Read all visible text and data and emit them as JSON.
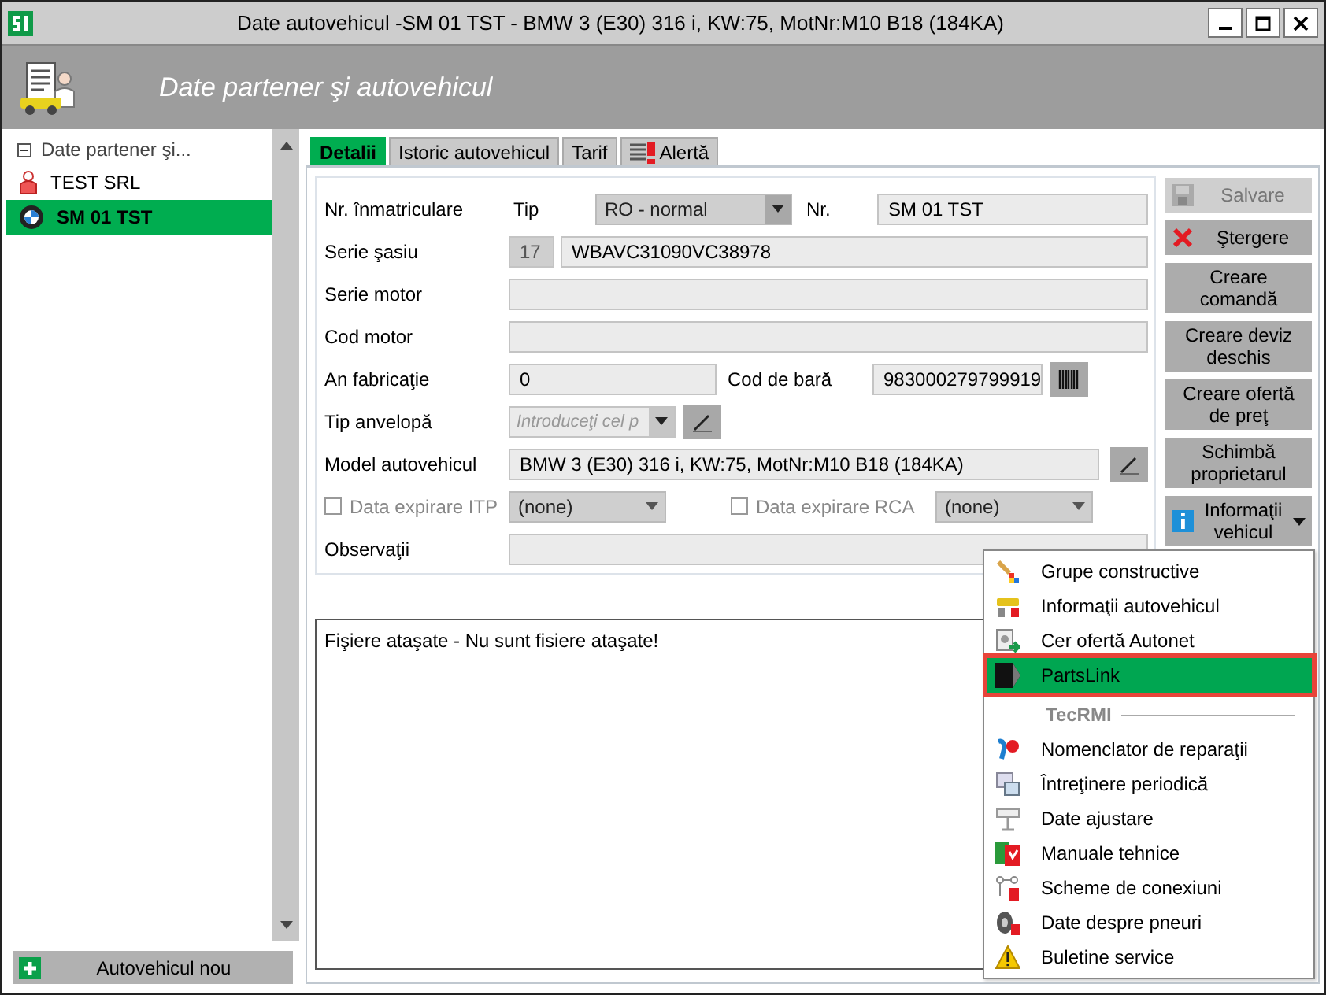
{
  "window": {
    "title": "Date autovehicul -SM 01 TST - BMW 3 (E30) 316 i, KW:75, MotNr:M10 B18 (184KA)"
  },
  "header": {
    "title": "Date partener şi autovehicul"
  },
  "tree": {
    "label": "Date partener şi...",
    "expanded": true,
    "children": [
      {
        "label": "TEST SRL",
        "kind": "partner",
        "selected": false
      },
      {
        "label": "SM 01 TST",
        "kind": "vehicle",
        "selected": true
      }
    ]
  },
  "new_vehicle_button": "Autovehicul nou",
  "tabs": [
    {
      "label": "Detalii",
      "selected": true
    },
    {
      "label": "Istoric autovehicul",
      "selected": false
    },
    {
      "label": "Tarif",
      "selected": false
    },
    {
      "label": "Alertă",
      "selected": false,
      "kind": "alert"
    }
  ],
  "form": {
    "registration": {
      "label": "Nr. înmatriculare",
      "type_label": "Tip",
      "type_value": "RO - normal",
      "number_label": "Nr.",
      "number_value": "SM 01 TST"
    },
    "chassis": {
      "label": "Serie şasiu",
      "length": "17",
      "value": "WBAVC31090VC38978"
    },
    "engine_series": {
      "label": "Serie motor"
    },
    "engine_code": {
      "label": "Cod motor"
    },
    "year": {
      "label": "An fabricaţie",
      "value": "0",
      "barcode_label": "Cod de bară",
      "barcode_value": "983000279799919"
    },
    "tire_type": {
      "label": "Tip anvelopă",
      "placeholder": "Introduceţi cel p"
    },
    "model": {
      "label": "Model autovehicul",
      "value": "BMW 3 (E30) 316 i, KW:75, MotNr:M10 B18 (184KA)"
    },
    "itp": {
      "label": "Data expirare ITP",
      "checked": false,
      "disabled": true,
      "value": "(none)"
    },
    "rca": {
      "label": "Data expirare RCA",
      "checked": false,
      "disabled": true,
      "value": "(none)"
    },
    "notes": {
      "label": "Observaţii"
    }
  },
  "actions": [
    {
      "label": "Salvare",
      "kind": "save",
      "disabled": true
    },
    {
      "label": "Ştergere",
      "kind": "delete",
      "disabled": false
    },
    {
      "label": "Creare comandă",
      "kind": "plain",
      "disabled": false
    },
    {
      "label": "Creare deviz deschis",
      "kind": "plain",
      "disabled": false
    },
    {
      "label": "Creare ofertă de preţ",
      "kind": "plain",
      "disabled": false
    },
    {
      "label": "Schimbă proprietarul",
      "kind": "plain",
      "disabled": false
    },
    {
      "label": "Informaţii vehicul",
      "kind": "info",
      "disabled": false
    }
  ],
  "attachments": {
    "text": "Fişiere ataşate - Nu sunt fisiere ataşate!"
  },
  "vehicle_menu": {
    "items": [
      {
        "kind": "item",
        "label": "Grupe constructive",
        "selected": false
      },
      {
        "kind": "item",
        "label": "Informaţii autovehicul",
        "selected": false
      },
      {
        "kind": "item",
        "label": "Cer ofertă Autonet",
        "selected": false
      },
      {
        "kind": "item",
        "label": "PartsLink",
        "selected": true
      },
      {
        "kind": "heading",
        "label": "TecRMI"
      },
      {
        "kind": "item",
        "label": "Nomenclator de reparaţii",
        "selected": false
      },
      {
        "kind": "item",
        "label": "Întreţinere periodică",
        "selected": false
      },
      {
        "kind": "item",
        "label": "Date ajustare",
        "selected": false
      },
      {
        "kind": "item",
        "label": "Manuale tehnice",
        "selected": false
      },
      {
        "kind": "item",
        "label": "Scheme de conexiuni",
        "selected": false
      },
      {
        "kind": "item",
        "label": "Date despre pneuri",
        "selected": false
      },
      {
        "kind": "item",
        "label": "Buletine service",
        "selected": false
      }
    ]
  }
}
